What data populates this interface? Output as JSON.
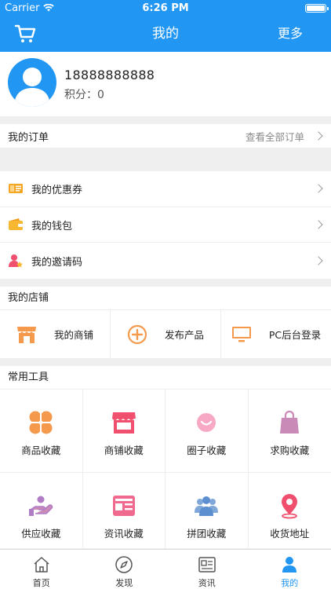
{
  "status": {
    "carrier": "Carrier",
    "time": "6:26 PM"
  },
  "nav": {
    "title": "我的",
    "more": "更多"
  },
  "profile": {
    "phone": "18888888888",
    "points_label": "积分：",
    "points": "0"
  },
  "order": {
    "title": "我的订单",
    "view_all": "查看全部订单"
  },
  "wallet": {
    "items": [
      {
        "label": "我的优惠券",
        "icon": "coupon-icon"
      },
      {
        "label": "我的钱包",
        "icon": "wallet-icon"
      },
      {
        "label": "我的邀请码",
        "icon": "invite-icon"
      }
    ]
  },
  "store": {
    "title": "我的店铺",
    "items": [
      {
        "label": "我的商铺",
        "icon": "shop-icon"
      },
      {
        "label": "发布产品",
        "icon": "plus-circle-icon"
      },
      {
        "label": "PC后台登录",
        "icon": "monitor-icon"
      }
    ]
  },
  "tools": {
    "title": "常用工具",
    "items": [
      {
        "label": "商品收藏",
        "icon": "goods-icon"
      },
      {
        "label": "商铺收藏",
        "icon": "store-icon"
      },
      {
        "label": "圈子收藏",
        "icon": "smile-icon"
      },
      {
        "label": "求购收藏",
        "icon": "bag-icon"
      },
      {
        "label": "供应收藏",
        "icon": "supply-icon"
      },
      {
        "label": "资讯收藏",
        "icon": "news-icon"
      },
      {
        "label": "拼团收藏",
        "icon": "group-icon"
      },
      {
        "label": "收货地址",
        "icon": "location-icon"
      }
    ]
  },
  "tabbar": {
    "items": [
      {
        "label": "首页",
        "icon": "home-icon"
      },
      {
        "label": "发现",
        "icon": "compass-icon"
      },
      {
        "label": "资讯",
        "icon": "news-tab-icon"
      },
      {
        "label": "我的",
        "icon": "user-icon",
        "active": true
      }
    ]
  },
  "colors": {
    "primary": "#2196f3",
    "orange": "#f59a4d",
    "red": "#f0506e",
    "pink": "#f06a8f",
    "purple": "#c98ab8",
    "blue": "#5b9bd5"
  }
}
